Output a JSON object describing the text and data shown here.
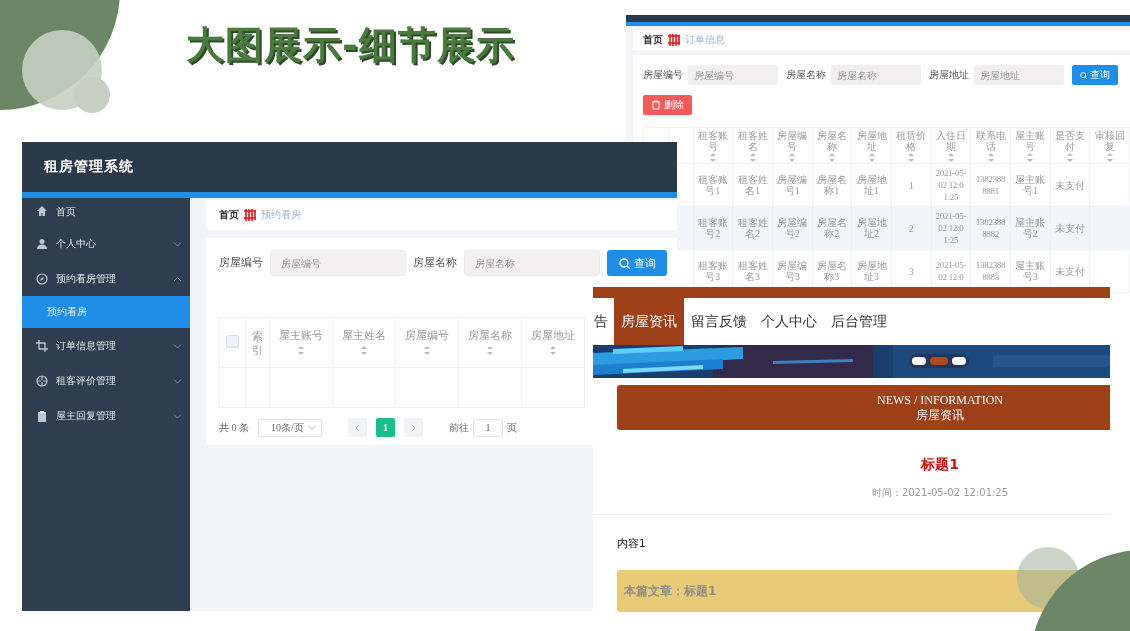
{
  "slide": {
    "title": "大图展示-细节展示"
  },
  "order_screen": {
    "breadcrumb": {
      "home": "首页",
      "current": "订单信息"
    },
    "search_fields": [
      {
        "label": "房屋编号",
        "placeholder": "房屋编号"
      },
      {
        "label": "房屋名称",
        "placeholder": "房屋名称"
      },
      {
        "label": "房屋地址",
        "placeholder": "房屋地址"
      }
    ],
    "search_button": "查询",
    "delete_button": "删除",
    "table": {
      "columns": [
        "租客账号",
        "租客姓名",
        "房屋编号",
        "房屋名称",
        "房屋地址",
        "租赁价格",
        "入住日期",
        "联系电话",
        "屋主账号",
        "是否支付",
        "审核回复"
      ],
      "rows": [
        [
          "租客账号1",
          "租客姓名1",
          "房屋编号1",
          "房屋名称1",
          "房屋地址1",
          "1",
          "2021-05-02 12:01:25",
          "13823888881",
          "屋主账号1",
          "未支付"
        ],
        [
          "租客账号2",
          "租客姓名2",
          "房屋编号2",
          "房屋名称2",
          "房屋地址2",
          "2",
          "2021-05-02 12:01:25",
          "13823888882",
          "屋主账号2",
          "未支付"
        ],
        [
          "租客账号3",
          "租客姓名3",
          "房屋编号3",
          "房屋名称3",
          "房屋地址3",
          "3",
          "2021-05-02 12:0",
          "13823888883",
          "屋主账号3",
          "未支付"
        ]
      ]
    }
  },
  "rental_screen": {
    "app_title": "租房管理系统",
    "sidebar": {
      "items": [
        {
          "label": "首页",
          "kind": "link",
          "selected": false
        },
        {
          "label": "个人中心",
          "kind": "group",
          "expanded": false
        },
        {
          "label": "预约看房管理",
          "kind": "group",
          "expanded": true,
          "children": [
            {
              "label": "预约看房",
              "selected": true
            }
          ]
        },
        {
          "label": "订单信息管理",
          "kind": "group",
          "expanded": false
        },
        {
          "label": "租客评价管理",
          "kind": "group",
          "expanded": false
        },
        {
          "label": "屋主回复管理",
          "kind": "group",
          "expanded": false
        }
      ]
    },
    "breadcrumb": {
      "home": "首页",
      "current": "预约看房"
    },
    "search_fields": [
      {
        "label": "房屋编号",
        "placeholder": "房屋编号"
      },
      {
        "label": "房屋名称",
        "placeholder": "房屋名称"
      }
    ],
    "search_button": "查询",
    "table": {
      "select_all_checked": false,
      "columns": [
        {
          "label": "索引",
          "sortable": false
        },
        {
          "label": "屋主账号",
          "sortable": true
        },
        {
          "label": "屋主姓名",
          "sortable": true
        },
        {
          "label": "房屋编号",
          "sortable": true
        },
        {
          "label": "房屋名称",
          "sortable": true
        },
        {
          "label": "房屋地址",
          "sortable": true
        }
      ]
    },
    "pagination": {
      "total": "共 0 条",
      "page_size": "10条/页",
      "prev_disabled": true,
      "next_disabled": true,
      "pages": [
        {
          "label": "1",
          "selected": true
        }
      ],
      "goto_label": "前往",
      "goto_value": "1",
      "goto_suffix": "页"
    }
  },
  "news_screen": {
    "nav": [
      {
        "label": "告",
        "selected": false
      },
      {
        "label": "房屋资讯",
        "selected": true
      },
      {
        "label": "留言反馈",
        "selected": false
      },
      {
        "label": "个人中心",
        "selected": false
      },
      {
        "label": "后台管理",
        "selected": false
      }
    ],
    "carousel_dots": [
      {
        "selected": false
      },
      {
        "selected": true
      },
      {
        "selected": false
      }
    ],
    "section": {
      "english": "NEWS / INFORMATION",
      "chinese": "房屋资讯"
    },
    "article": {
      "title": "标题1",
      "time": "时间：2021-05-02 12:01:25",
      "body": "内容1",
      "footer": "本篇文章：标题1"
    }
  }
}
